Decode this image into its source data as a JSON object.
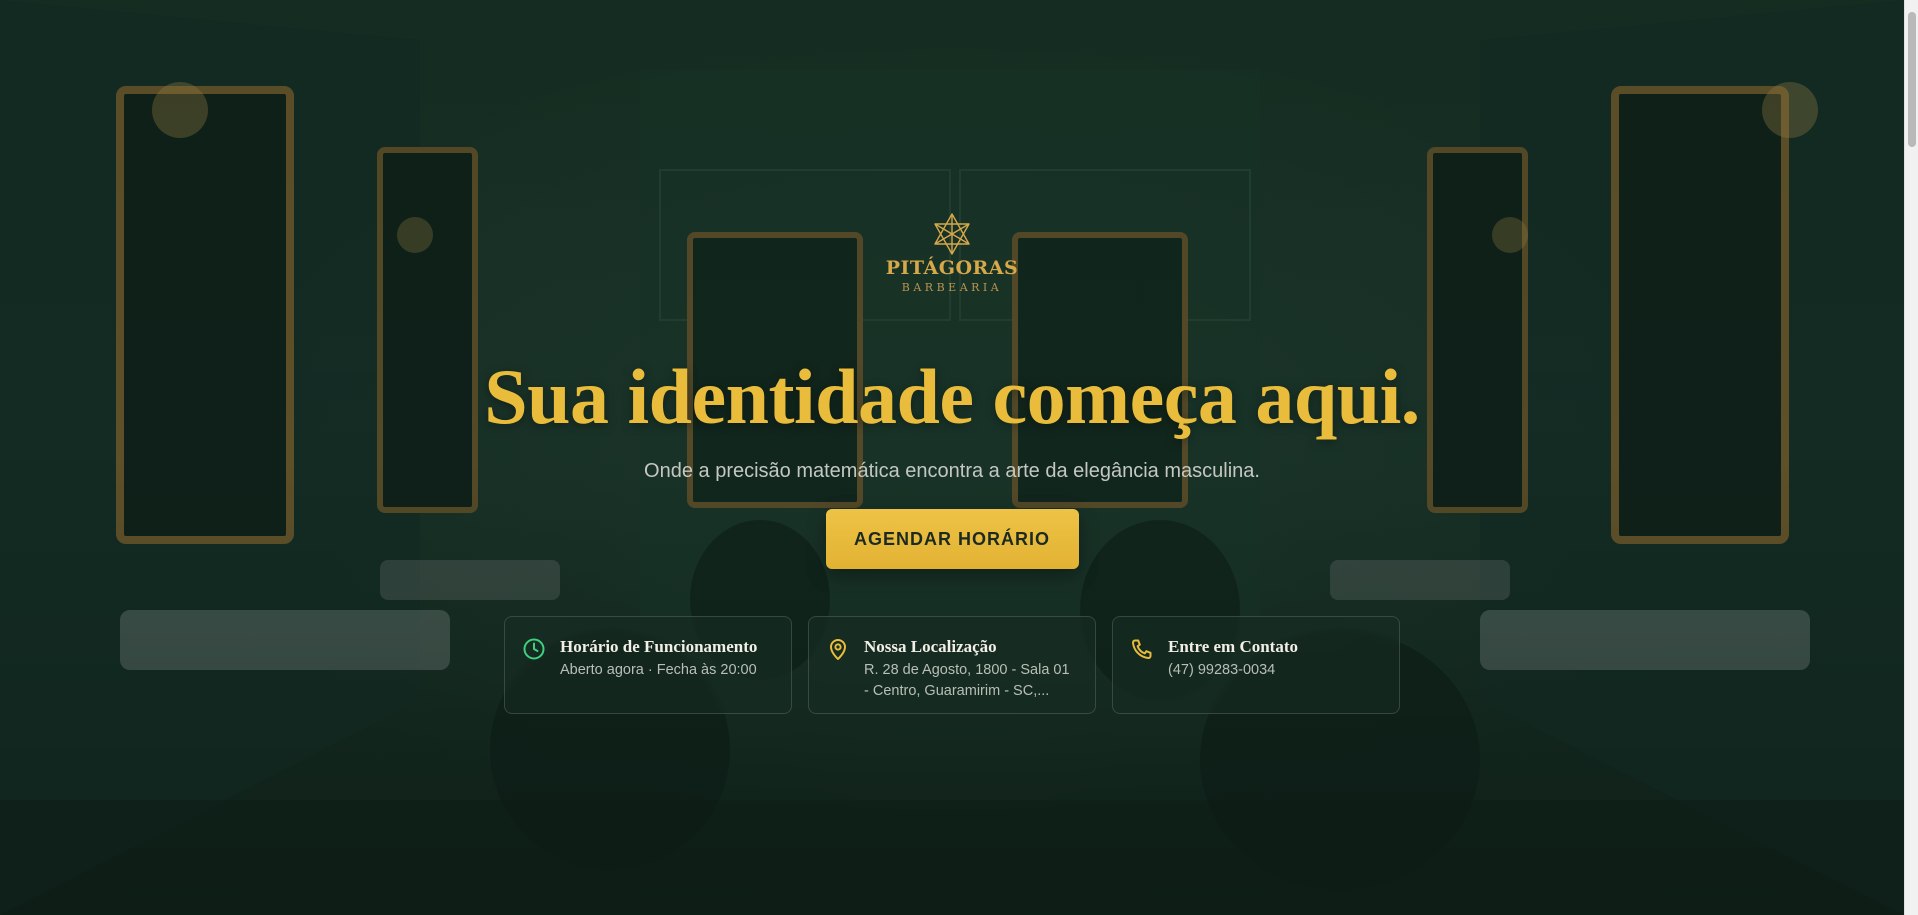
{
  "brand": {
    "name": "PITÁGORAS",
    "tagline": "BARBEARIA",
    "logo_icon": "star-tetrahedron-icon",
    "accent": "#e9bd3b"
  },
  "hero": {
    "headline": "Sua identidade começa aqui.",
    "subheadline": "Onde a precisão matemática encontra a arte da elegância masculina.",
    "cta_label": "AGENDAR HORÁRIO"
  },
  "info_cards": [
    {
      "icon": "clock-icon",
      "title": "Horário de Funcionamento",
      "text": "Aberto agora · Fecha às 20:00",
      "icon_color": "#3fcf7e"
    },
    {
      "icon": "map-pin-icon",
      "title": "Nossa Localização",
      "text": "R. 28 de Agosto, 1800 - Sala 01 - Centro, Guaramirim - SC,...",
      "icon_color": "#e9bd3b"
    },
    {
      "icon": "phone-icon",
      "title": "Entre em Contato",
      "text": "(47) 99283-0034",
      "icon_color": "#e9bd3b"
    }
  ]
}
